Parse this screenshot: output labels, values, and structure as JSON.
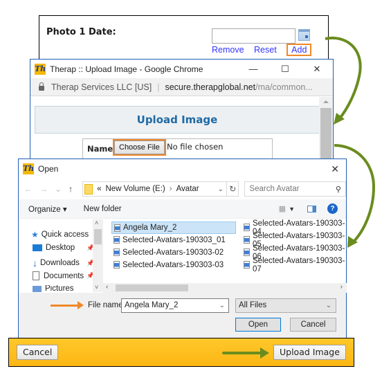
{
  "photo_form": {
    "label": "Photo 1 Date:",
    "date_value": "",
    "links": {
      "remove": "Remove",
      "reset": "Reset",
      "add": "Add"
    }
  },
  "chrome": {
    "title": "Therap :: Upload Image - Google Chrome",
    "logo": "Th",
    "controls": {
      "minimize": "—",
      "maximize": "☐",
      "close": "✕"
    },
    "address": {
      "org": "Therap Services LLC [US]",
      "host": "secure.therapglobal.net",
      "path": "/ma/common..."
    },
    "page": {
      "header": "Upload Image",
      "name_label": "Name",
      "choose_file": "Choose File",
      "file_status": "No file chosen"
    }
  },
  "open_dialog": {
    "title": "Open",
    "logo": "Th",
    "close": "✕",
    "nav": {
      "back": "←",
      "forward": "→",
      "recent": "⌄",
      "up": "↑"
    },
    "path": {
      "prefix": "«",
      "segments": [
        "New Volume (E:)",
        "Avatar"
      ],
      "separator": "›"
    },
    "refresh": "↻",
    "search_placeholder": "Search Avatar",
    "toolbar": {
      "organize": "Organize ▾",
      "new_folder": "New folder",
      "help": "?"
    },
    "sidebar": [
      {
        "label": "Quick access",
        "icon": "star-icon"
      },
      {
        "label": "Desktop",
        "icon": "desktop-icon",
        "pinned": true
      },
      {
        "label": "Downloads",
        "icon": "download-icon",
        "pinned": true
      },
      {
        "label": "Documents",
        "icon": "document-icon",
        "pinned": true
      },
      {
        "label": "Pictures",
        "icon": "pictures-icon",
        "pinned": true
      }
    ],
    "files": [
      {
        "name": "Angela Mary_2",
        "selected": true
      },
      {
        "name": "Selected-Avatars-190303_01"
      },
      {
        "name": "Selected-Avatars-190303-02"
      },
      {
        "name": "Selected-Avatars-190303-03"
      },
      {
        "name": "Selected-Avatars-190303-04"
      },
      {
        "name": "Selected-Avatars-190303-05"
      },
      {
        "name": "Selected-Avatars-190303-06"
      },
      {
        "name": "Selected-Avatars-190303-07"
      }
    ],
    "file_name_label": "File name:",
    "file_name_value": "Angela Mary_2",
    "file_type": "All Files",
    "open_label": "Open",
    "cancel_label": "Cancel"
  },
  "footer": {
    "cancel_label": "Cancel",
    "upload_label": "Upload Image"
  },
  "colors": {
    "highlight_orange": "#f0882a",
    "arrow_green": "#6a8c1f",
    "footer_yellow": "#fdb614",
    "link_blue": "#3333ff",
    "header_blue": "#1f6aa5"
  }
}
